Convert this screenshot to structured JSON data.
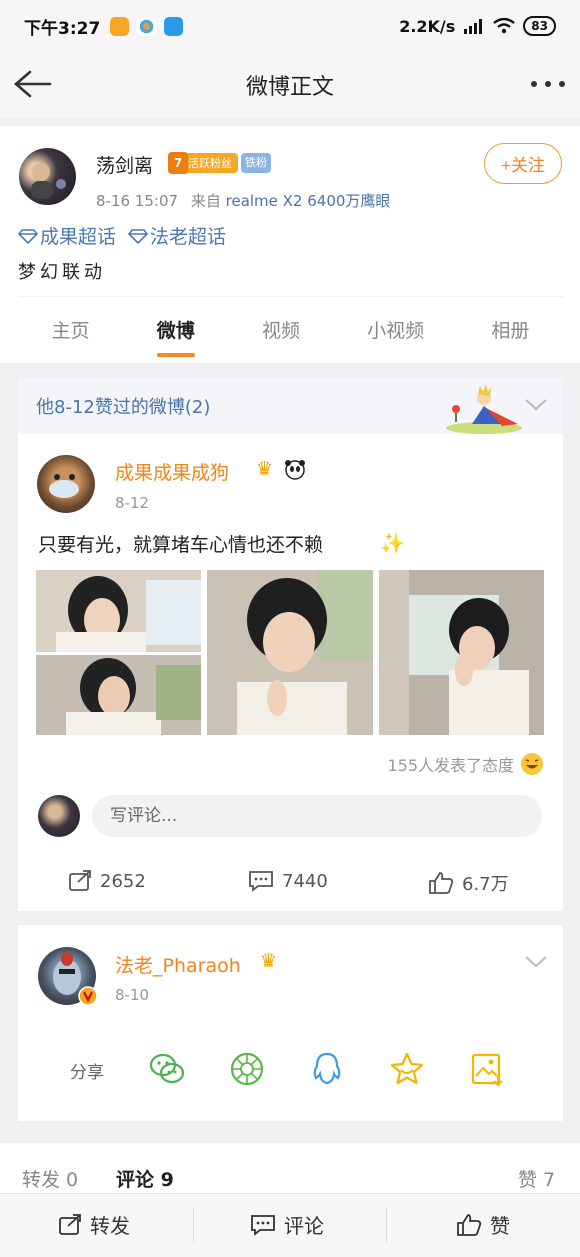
{
  "status": {
    "time": "下午3:27",
    "speed": "2.2K/s",
    "battery": "83"
  },
  "nav": {
    "title": "微博正文"
  },
  "author": {
    "name": "荡剑离",
    "fan_level": "7",
    "fan_badge": "活跃粉丝",
    "iron_badge": "铁粉",
    "date": "8-16 15:07",
    "from": "来自",
    "device": "realme X2 6400万鹰眼",
    "follow": "+关注"
  },
  "topics": [
    "成果超话",
    "法老超话"
  ],
  "post_text": "梦幻联动",
  "tabs": [
    {
      "label": "主页"
    },
    {
      "label": "微博"
    },
    {
      "label": "视频"
    },
    {
      "label": "小视频"
    },
    {
      "label": "相册"
    }
  ],
  "liked_header": "他8-12赞过的微博(2)",
  "post1": {
    "name": "成果成果成狗",
    "date": "8-12",
    "text": "只要有光，就算堵车心情也还不赖",
    "reactions": "155人发表了态度",
    "comment_placeholder": "写评论...",
    "reposts": "2652",
    "comments": "7440",
    "likes": "6.7万"
  },
  "post2": {
    "name": "法老_Pharaoh",
    "date": "8-10",
    "share_label": "分享"
  },
  "bottom_tabs": {
    "repost": "转发 0",
    "comment": "评论 9",
    "like": "赞 7"
  },
  "actions": {
    "repost": "转发",
    "comment": "评论",
    "like": "赞"
  },
  "colors": {
    "accent": "#f0851c",
    "link": "#4a74a8",
    "wechat": "#4bb34b",
    "moments": "#5bb84a",
    "qq": "#3b9ce6",
    "favorite": "#f6b500"
  }
}
